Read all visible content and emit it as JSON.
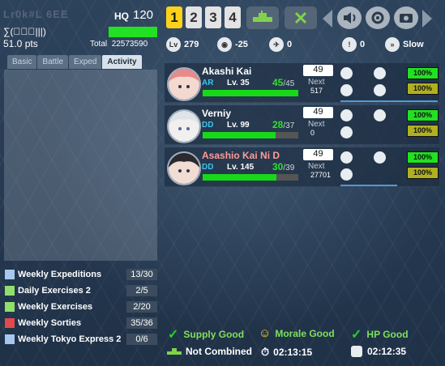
{
  "header": {
    "admiral_name": "Lr0k#L 6EE",
    "hq_label": "HQ",
    "hq_level": "120",
    "nickname": "∑(ﾟ∇ﾟ|||)",
    "points": "51.0 pts",
    "total_label": "Total",
    "total_value": "22573590"
  },
  "tabs": [
    {
      "label": "Basic"
    },
    {
      "label": "Battle"
    },
    {
      "label": "Exped"
    },
    {
      "label": "Activity"
    }
  ],
  "quests": [
    {
      "name": "Weekly Expeditions",
      "count": "13/30",
      "color": "#a6c8ee"
    },
    {
      "name": "Daily Exercises 2",
      "count": "2/5",
      "color": "#8fe06a"
    },
    {
      "name": "Weekly Exercises",
      "count": "2/20",
      "color": "#8fe06a"
    },
    {
      "name": "Weekly Sorties",
      "count": "35/36",
      "color": "#e04a4a"
    },
    {
      "name": "Weekly Tokyo Express 2",
      "count": "0/6",
      "color": "#a6c8ee"
    }
  ],
  "fleets": [
    "1",
    "2",
    "3",
    "4"
  ],
  "fleet_stats": {
    "level_total": "279",
    "los": "-25",
    "aa": "0",
    "tp": "0",
    "speed": "Slow"
  },
  "ships": [
    {
      "name": "Akashi Kai",
      "name_color": "#ffffff",
      "type": "AR",
      "type_color": "#38c6ef",
      "level": "Lv. 35",
      "hp": "45",
      "hp_max": "/45",
      "hp_frac": 1.0,
      "morale": "49",
      "next_label": "Next",
      "next": "517",
      "fuel": "100%",
      "ammo": "100%"
    },
    {
      "name": "Verniy",
      "name_color": "#ffffff",
      "type": "DD",
      "type_color": "#38c6ef",
      "level": "Lv. 99",
      "hp": "28",
      "hp_max": "/37",
      "hp_frac": 0.76,
      "morale": "49",
      "next_label": "Next",
      "next": "0",
      "fuel": "100%",
      "ammo": "100%"
    },
    {
      "name": "Asashio Kai Ni D",
      "name_color": "#ff9a9a",
      "type": "DD",
      "type_color": "#38c6ef",
      "level": "Lv. 145",
      "hp": "30",
      "hp_max": "/39",
      "hp_frac": 0.77,
      "morale": "49",
      "next_label": "Next",
      "next": "27701",
      "fuel": "100%",
      "ammo": "100%"
    }
  ],
  "status": {
    "supply": "Supply Good",
    "morale": "Morale Good",
    "hp": "HP Good",
    "combined": "Not Combined",
    "timer1": "02:13:15",
    "timer2": "02:12:35"
  },
  "icons": {
    "ship": "ship-icon",
    "swords": "battle-icon",
    "speaker": "speaker-icon",
    "settings": "gear-icon",
    "camera": "camera-icon"
  }
}
